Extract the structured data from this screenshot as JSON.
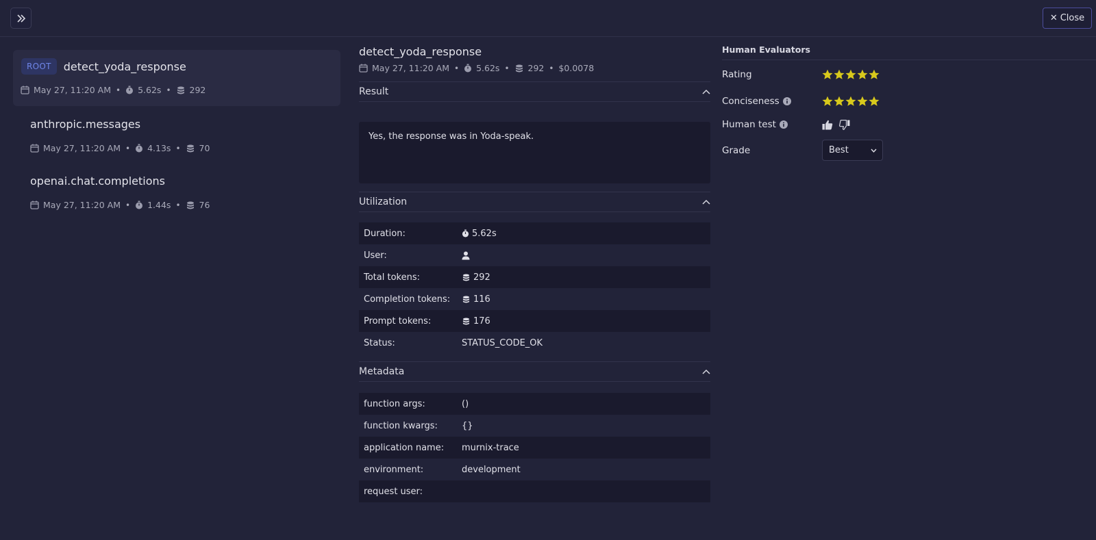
{
  "topbar": {
    "expand_icon": "double-chevron-right-icon",
    "close_label": "Close"
  },
  "spans": [
    {
      "badge": "ROOT",
      "name": "detect_yoda_response",
      "date": "May 27, 11:20 AM",
      "duration": "5.62s",
      "tokens": "292"
    },
    {
      "name": "anthropic.messages",
      "date": "May 27, 11:20 AM",
      "duration": "4.13s",
      "tokens": "70"
    },
    {
      "name": "openai.chat.completions",
      "date": "May 27, 11:20 AM",
      "duration": "1.44s",
      "tokens": "76"
    }
  ],
  "detail": {
    "title": "detect_yoda_response",
    "date": "May 27, 11:20 AM",
    "duration": "5.62s",
    "tokens": "292",
    "cost": "$0.0078",
    "result_heading": "Result",
    "result_text": "Yes, the response was in Yoda-speak.",
    "utilization_heading": "Utilization",
    "utilization": [
      {
        "key": "Duration:",
        "value": "5.62s",
        "icon": "stopwatch-icon"
      },
      {
        "key": "User:",
        "value": "",
        "icon": "user-icon"
      },
      {
        "key": "Total tokens:",
        "value": "292",
        "icon": "coins-icon"
      },
      {
        "key": "Completion tokens:",
        "value": "116",
        "icon": "coins-icon"
      },
      {
        "key": "Prompt tokens:",
        "value": "176",
        "icon": "coins-icon"
      },
      {
        "key": "Status:",
        "value": "STATUS_CODE_OK",
        "icon": ""
      }
    ],
    "metadata_heading": "Metadata",
    "metadata": [
      {
        "key": "function args:",
        "value": "()"
      },
      {
        "key": "function kwargs:",
        "value": "{}"
      },
      {
        "key": "application name:",
        "value": "murnix-trace"
      },
      {
        "key": "environment:",
        "value": "development"
      },
      {
        "key": "request user:",
        "value": ""
      }
    ]
  },
  "evaluators": {
    "title": "Human Evaluators",
    "rating_label": "Rating",
    "rating_value": 5,
    "conciseness_label": "Conciseness",
    "conciseness_value": 5,
    "human_test_label": "Human test",
    "grade_label": "Grade",
    "grade_value": "Best",
    "star_color": "#d8c91c"
  }
}
